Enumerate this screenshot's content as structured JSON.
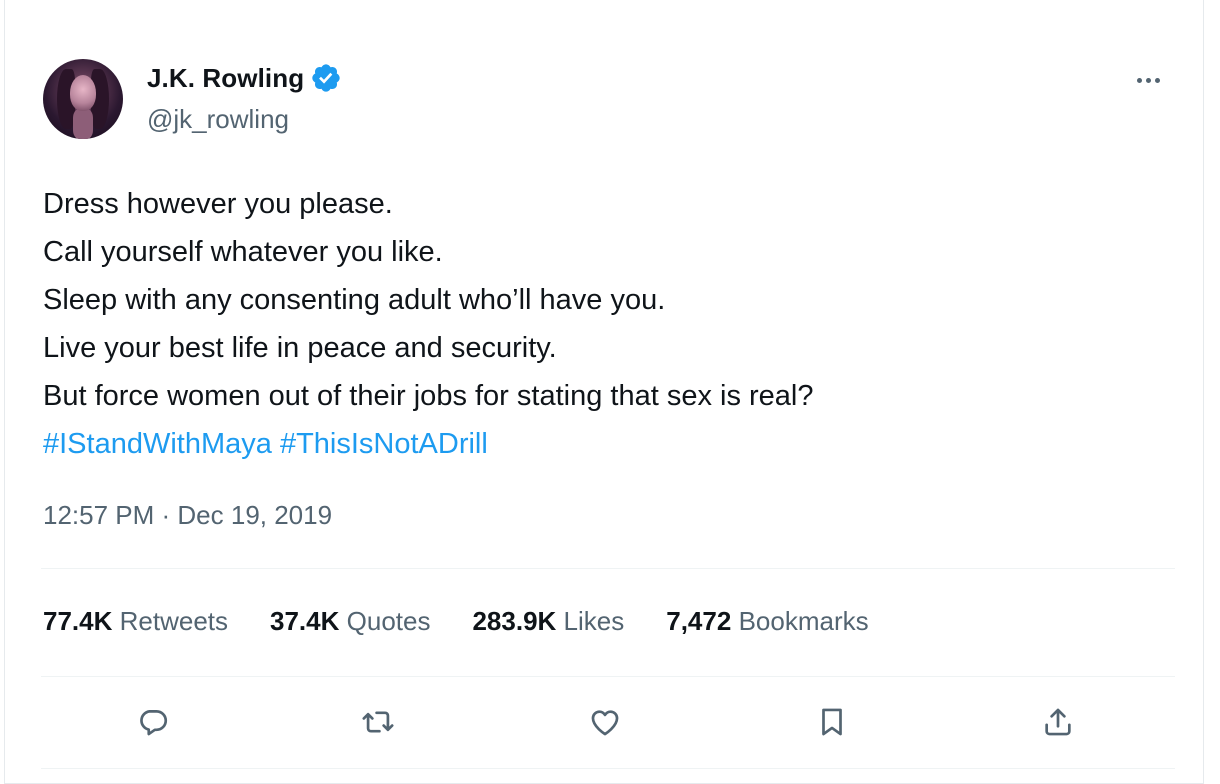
{
  "author": {
    "display_name": "J.K. Rowling",
    "handle": "@jk_rowling",
    "verified": true
  },
  "tweet": {
    "lines": [
      "Dress however you please.",
      "Call yourself whatever you like.",
      "Sleep with any consenting adult who’ll have you.",
      "Live your best life in peace and security.",
      "But force women out of their jobs for stating that sex is real?"
    ],
    "hashtags": "#IStandWithMaya #ThisIsNotADrill",
    "timestamp": "12:57 PM · Dec 19, 2019"
  },
  "stats": {
    "retweets": {
      "count": "77.4K",
      "label": "Retweets"
    },
    "quotes": {
      "count": "37.4K",
      "label": "Quotes"
    },
    "likes": {
      "count": "283.9K",
      "label": "Likes"
    },
    "bookmarks": {
      "count": "7,472",
      "label": "Bookmarks"
    }
  },
  "icons": {
    "verified": "verified-badge-icon",
    "more": "more-icon",
    "reply": "reply-icon",
    "retweet": "retweet-icon",
    "like": "like-icon",
    "bookmark": "bookmark-icon",
    "share": "share-icon"
  },
  "colors": {
    "text": "#0f1419",
    "secondary": "#536471",
    "link": "#1d9bf0",
    "verified": "#1d9bf0",
    "divider": "#eff3f4"
  }
}
